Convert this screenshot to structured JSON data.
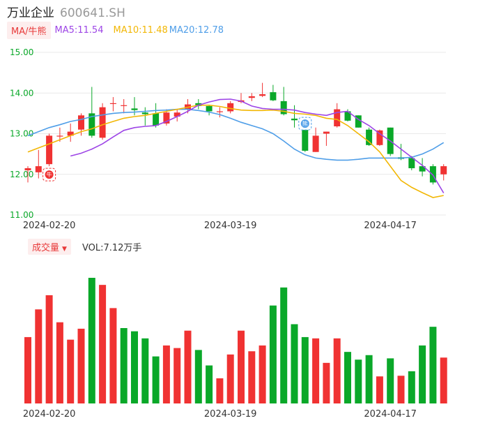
{
  "header": {
    "name": "万业企业",
    "code": "600641.SH"
  },
  "legend": {
    "ma_tag": "MA/牛熊",
    "ma5": "MA5:11.54",
    "ma10": "MA10:11.48",
    "ma20": "MA20:12.78"
  },
  "volume_legend": {
    "tag": "成交量",
    "text": "VOL:7.12万手"
  },
  "colors": {
    "up": "#f03232",
    "down": "#0aa829",
    "ma5": "#9d45e6",
    "ma10": "#f2b705",
    "ma20": "#4f9ee8",
    "axis_text": "#0aa829"
  },
  "chart_data": [
    {
      "type": "candlestick",
      "y_ticks": [
        "15.00",
        "14.00",
        "13.00",
        "12.00",
        "11.00"
      ],
      "ylim": [
        11.0,
        15.0
      ],
      "x_tick_labels": [
        {
          "index": 2,
          "label": "2024-02-20"
        },
        {
          "index": 19,
          "label": "2024-03-19"
        },
        {
          "index": 34,
          "label": "2024-04-17"
        }
      ],
      "candles": [
        {
          "o": 12.1,
          "c": 12.15,
          "h": 12.2,
          "l": 11.8
        },
        {
          "o": 12.05,
          "c": 12.2,
          "h": 12.6,
          "l": 11.9
        },
        {
          "o": 12.25,
          "c": 12.95,
          "h": 13.0,
          "l": 12.2
        },
        {
          "o": 12.95,
          "c": 12.95,
          "h": 13.15,
          "l": 12.8
        },
        {
          "o": 12.95,
          "c": 13.05,
          "h": 13.25,
          "l": 12.8
        },
        {
          "o": 13.1,
          "c": 13.45,
          "h": 13.5,
          "l": 12.95
        },
        {
          "o": 13.5,
          "c": 12.95,
          "h": 14.15,
          "l": 12.9
        },
        {
          "o": 12.9,
          "c": 13.65,
          "h": 13.75,
          "l": 12.85
        },
        {
          "o": 13.75,
          "c": 13.75,
          "h": 13.9,
          "l": 13.55
        },
        {
          "o": 13.7,
          "c": 13.7,
          "h": 13.85,
          "l": 13.5
        },
        {
          "o": 13.62,
          "c": 13.58,
          "h": 13.9,
          "l": 13.45
        },
        {
          "o": 13.52,
          "c": 13.48,
          "h": 13.65,
          "l": 13.2
        },
        {
          "o": 13.5,
          "c": 13.2,
          "h": 13.75,
          "l": 13.15
        },
        {
          "o": 13.25,
          "c": 13.52,
          "h": 13.6,
          "l": 13.2
        },
        {
          "o": 13.42,
          "c": 13.52,
          "h": 13.6,
          "l": 13.3
        },
        {
          "o": 13.6,
          "c": 13.72,
          "h": 13.85,
          "l": 13.5
        },
        {
          "o": 13.75,
          "c": 13.68,
          "h": 13.85,
          "l": 13.6
        },
        {
          "o": 13.68,
          "c": 13.55,
          "h": 13.7,
          "l": 13.45
        },
        {
          "o": 13.55,
          "c": 13.55,
          "h": 13.65,
          "l": 13.4
        },
        {
          "o": 13.55,
          "c": 13.75,
          "h": 13.8,
          "l": 13.5
        },
        {
          "o": 13.78,
          "c": 13.82,
          "h": 14.0,
          "l": 13.75
        },
        {
          "o": 13.88,
          "c": 13.92,
          "h": 14.0,
          "l": 13.8
        },
        {
          "o": 13.93,
          "c": 13.97,
          "h": 14.25,
          "l": 13.9
        },
        {
          "o": 14.02,
          "c": 13.82,
          "h": 14.2,
          "l": 13.8
        },
        {
          "o": 13.8,
          "c": 13.48,
          "h": 14.15,
          "l": 13.45
        },
        {
          "o": 13.37,
          "c": 13.33,
          "h": 13.7,
          "l": 13.15
        },
        {
          "o": 13.28,
          "c": 12.58,
          "h": 13.35,
          "l": 12.55
        },
        {
          "o": 12.55,
          "c": 12.95,
          "h": 13.15,
          "l": 12.55
        },
        {
          "o": 13.0,
          "c": 13.05,
          "h": 13.05,
          "l": 12.7
        },
        {
          "o": 13.18,
          "c": 13.6,
          "h": 13.75,
          "l": 13.15
        },
        {
          "o": 13.55,
          "c": 13.32,
          "h": 13.6,
          "l": 13.3
        },
        {
          "o": 13.45,
          "c": 13.15,
          "h": 13.45,
          "l": 13.15
        },
        {
          "o": 13.1,
          "c": 12.72,
          "h": 13.15,
          "l": 12.7
        },
        {
          "o": 12.72,
          "c": 13.08,
          "h": 13.1,
          "l": 12.7
        },
        {
          "o": 13.15,
          "c": 12.5,
          "h": 13.15,
          "l": 12.45
        },
        {
          "o": 12.42,
          "c": 12.38,
          "h": 12.75,
          "l": 12.35
        },
        {
          "o": 12.4,
          "c": 12.15,
          "h": 12.45,
          "l": 12.1
        },
        {
          "o": 12.2,
          "c": 12.07,
          "h": 12.4,
          "l": 11.95
        },
        {
          "o": 12.2,
          "c": 11.8,
          "h": 12.25,
          "l": 11.75
        },
        {
          "o": 12.0,
          "c": 12.2,
          "h": 12.25,
          "l": 11.85
        }
      ],
      "ma5": [
        null,
        null,
        null,
        null,
        12.45,
        12.52,
        12.62,
        12.75,
        12.92,
        13.08,
        13.15,
        13.18,
        13.2,
        13.3,
        13.42,
        13.55,
        13.7,
        13.78,
        13.84,
        13.85,
        13.8,
        13.68,
        13.62,
        13.6,
        13.6,
        13.58,
        13.52,
        13.48,
        13.45,
        13.52,
        13.55,
        13.35,
        13.2,
        13.0,
        12.82,
        12.62,
        12.42,
        12.22,
        11.98,
        11.54
      ],
      "ma10": [
        12.55,
        12.65,
        12.75,
        12.85,
        12.95,
        13.05,
        13.12,
        13.22,
        13.3,
        13.38,
        13.42,
        13.45,
        13.5,
        13.55,
        13.6,
        13.65,
        13.7,
        13.7,
        13.67,
        13.62,
        13.58,
        13.57,
        13.57,
        13.58,
        13.55,
        13.5,
        13.48,
        13.45,
        13.38,
        13.35,
        13.2,
        13.0,
        12.8,
        12.55,
        12.2,
        11.85,
        11.68,
        11.55,
        11.43,
        11.48
      ],
      "ma20": [
        12.95,
        13.05,
        13.15,
        13.22,
        13.3,
        13.35,
        13.42,
        13.46,
        13.5,
        13.52,
        13.53,
        13.55,
        13.57,
        13.58,
        13.6,
        13.6,
        13.57,
        13.53,
        13.47,
        13.38,
        13.28,
        13.2,
        13.12,
        13.0,
        12.82,
        12.62,
        12.48,
        12.4,
        12.37,
        12.35,
        12.35,
        12.37,
        12.4,
        12.4,
        12.4,
        12.4,
        12.42,
        12.5,
        12.62,
        12.78
      ],
      "markers": [
        {
          "index": 2,
          "label": "牛",
          "color": "#f03232"
        },
        {
          "index": 26,
          "label": "熊",
          "color": "#4f9ee8"
        }
      ]
    },
    {
      "type": "bar",
      "title": "成交量",
      "unit": "万手",
      "x_tick_labels": [
        {
          "index": 2,
          "label": "2024-02-20"
        },
        {
          "index": 19,
          "label": "2024-03-19"
        },
        {
          "index": 34,
          "label": "2024-04-17"
        }
      ],
      "values": [
        10.3,
        14.6,
        16.8,
        12.6,
        9.9,
        11.6,
        19.5,
        18.4,
        14.8,
        11.7,
        11.2,
        10.1,
        7.3,
        9.0,
        8.6,
        11.3,
        8.3,
        5.9,
        3.9,
        7.6,
        11.3,
        8.1,
        9.0,
        15.2,
        18.0,
        12.3,
        10.3,
        10.1,
        6.3,
        10.1,
        8.0,
        6.8,
        7.5,
        4.2,
        7.0,
        4.3,
        5.0,
        9.0,
        11.9,
        7.12
      ],
      "up": [
        true,
        true,
        true,
        true,
        true,
        true,
        false,
        true,
        true,
        false,
        false,
        false,
        false,
        true,
        true,
        true,
        false,
        false,
        true,
        true,
        true,
        true,
        true,
        false,
        false,
        false,
        false,
        true,
        true,
        true,
        false,
        false,
        false,
        true,
        false,
        true,
        false,
        false,
        false,
        true
      ]
    }
  ]
}
